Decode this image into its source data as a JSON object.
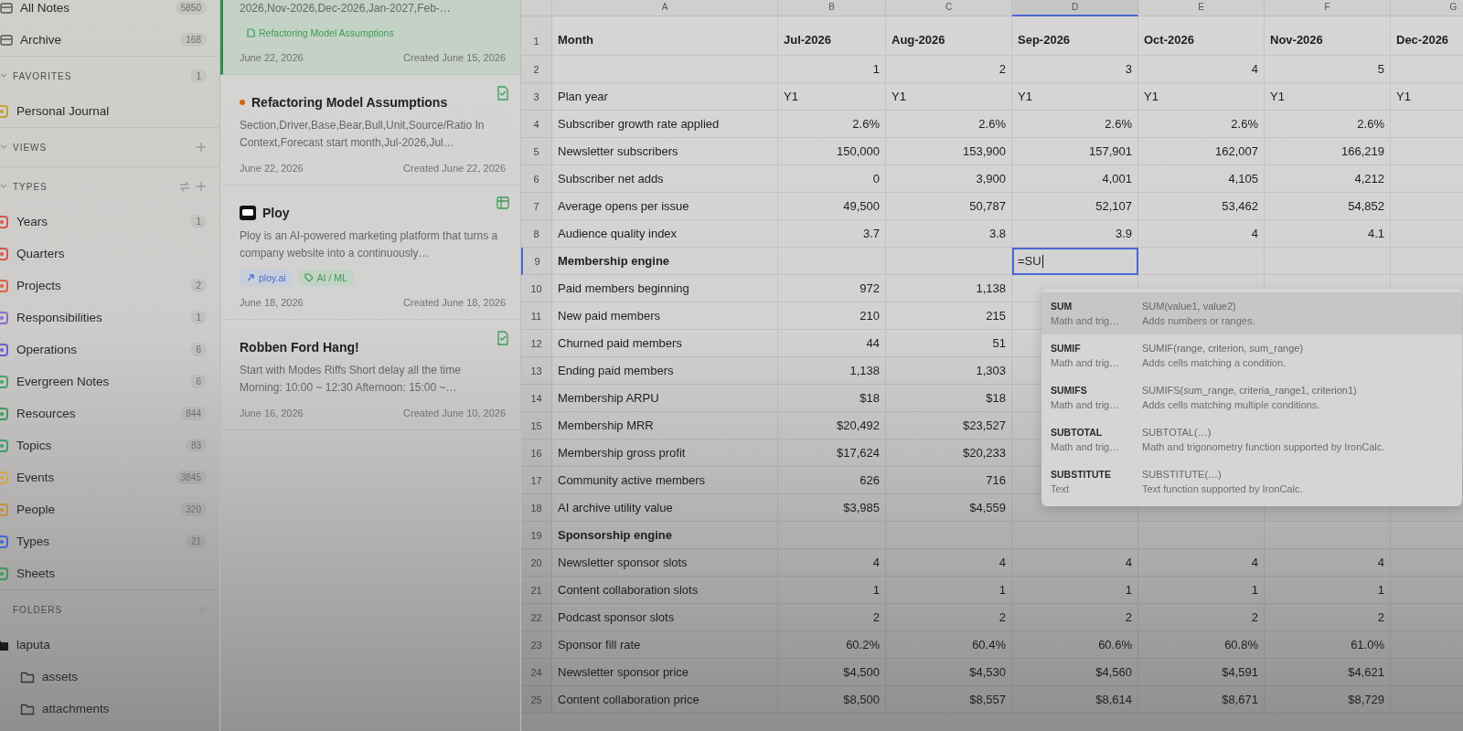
{
  "sidebar": {
    "nav": [
      {
        "label": "All Notes",
        "count": "5850"
      },
      {
        "label": "Archive",
        "count": "168"
      }
    ],
    "sections": [
      {
        "title": "FAVORITES",
        "count": "1",
        "expanded": true,
        "sort_button": false,
        "add_button": false,
        "items": [
          {
            "label": "Personal Journal",
            "color": "#c9a227"
          }
        ]
      },
      {
        "title": "VIEWS",
        "expanded": true,
        "sort_button": false,
        "add_button": true
      },
      {
        "title": "TYPES",
        "expanded": true,
        "sort_button": true,
        "add_button": true,
        "items": [
          {
            "label": "Years",
            "count": "1",
            "color": "#d9534f"
          },
          {
            "label": "Quarters",
            "color": "#d9534f"
          },
          {
            "label": "Projects",
            "count": "2",
            "color": "#e0603a"
          },
          {
            "label": "Responsibilities",
            "count": "1",
            "color": "#8a6bd1"
          },
          {
            "label": "Operations",
            "count": "6",
            "color": "#6b5bd1"
          },
          {
            "label": "Evergreen Notes",
            "count": "6",
            "color": "#3fa66b"
          },
          {
            "label": "Resources",
            "count": "844",
            "color": "#3f9a5a"
          },
          {
            "label": "Topics",
            "count": "83",
            "color": "#3aa070"
          },
          {
            "label": "Events",
            "count": "3845",
            "color": "#d9a53f"
          },
          {
            "label": "People",
            "count": "320",
            "color": "#c98f3a"
          },
          {
            "label": "Types",
            "count": "21",
            "color": "#3f6bd9"
          },
          {
            "label": "Sheets",
            "color": "#3f9a5a"
          }
        ]
      },
      {
        "title": "FOLDERS",
        "expanded": true,
        "sort_button": false,
        "add_button": true,
        "items": [
          {
            "label": "laputa",
            "kind": "folder",
            "children": [
              {
                "label": "assets",
                "kind": "folder"
              },
              {
                "label": "attachments",
                "kind": "folder"
              }
            ]
          }
        ]
      }
    ]
  },
  "notes": [
    {
      "selected": true,
      "kind": "none",
      "preview": "2026,Nov-2026,Dec-2026,Jan-2027,Feb-…",
      "chips": [
        {
          "kind": "note",
          "label": "Refactoring Model Assumptions"
        }
      ],
      "date": "June 22, 2026",
      "created": "Created June 15, 2026"
    },
    {
      "selected": false,
      "kind": "note",
      "logo": false,
      "color": "#d9640f",
      "title": "Refactoring Model Assumptions",
      "preview": "Section,Driver,Base,Bear,Bull,Unit,Source/Ratio In Context,Forecast start month,Jul-2026,Jul…",
      "date": "June 22, 2026",
      "created": "Created June 22, 2026"
    },
    {
      "selected": false,
      "kind": "sheet",
      "logo": true,
      "title": "Ploy",
      "preview": "Ploy is an AI-powered marketing platform that turns a company website into a continuously…",
      "chips": [
        {
          "kind": "link",
          "label": "ploy.ai"
        },
        {
          "kind": "tag",
          "label": "AI / ML"
        }
      ],
      "date": "June 18, 2026",
      "created": "Created June 18, 2026"
    },
    {
      "selected": false,
      "kind": "note",
      "logo": false,
      "title": "Robben Ford Hang!",
      "preview": "Start with Modes Riffs Short delay all the time Morning: 10:00 ~ 12:30 Afternoon: 15:00 ~…",
      "date": "June 16, 2026",
      "created": "Created June 10, 2026"
    }
  ],
  "sheet": {
    "columns": [
      {
        "label": "A",
        "selected": false
      },
      {
        "label": "B",
        "selected": false
      },
      {
        "label": "C",
        "selected": false
      },
      {
        "label": "D",
        "selected": true
      },
      {
        "label": "E",
        "selected": false
      },
      {
        "label": "F",
        "selected": false
      },
      {
        "label": "G",
        "selected": false
      }
    ],
    "rows": [
      {
        "number": "1",
        "kind": "header",
        "selected": false,
        "cells": [
          "Month",
          "Jul-2026",
          "Aug-2026",
          "Sep-2026",
          "Oct-2026",
          "Nov-2026",
          "Dec-2026"
        ]
      },
      {
        "number": "2",
        "kind": "number",
        "selected": false,
        "cells": [
          "",
          "1",
          "2",
          "3",
          "4",
          "5"
        ]
      },
      {
        "number": "3",
        "kind": "text",
        "selected": false,
        "cells": [
          "Plan year",
          "Y1",
          "Y1",
          "Y1",
          "Y1",
          "Y1",
          "Y1"
        ]
      },
      {
        "number": "4",
        "kind": "number",
        "selected": false,
        "cells": [
          "Subscriber growth rate applied",
          "2.6%",
          "2.6%",
          "2.6%",
          "2.6%",
          "2.6%"
        ]
      },
      {
        "number": "5",
        "kind": "number",
        "selected": false,
        "cells": [
          "Newsletter subscribers",
          "150,000",
          "153,900",
          "157,901",
          "162,007",
          "166,219"
        ]
      },
      {
        "number": "6",
        "kind": "number",
        "selected": false,
        "cells": [
          "Subscriber net adds",
          "0",
          "3,900",
          "4,001",
          "4,105",
          "4,212"
        ]
      },
      {
        "number": "7",
        "kind": "number",
        "selected": false,
        "cells": [
          "Average opens per issue",
          "49,500",
          "50,787",
          "52,107",
          "53,462",
          "54,852"
        ]
      },
      {
        "number": "8",
        "kind": "number",
        "selected": false,
        "cells": [
          "Audience quality index",
          "3.7",
          "3.8",
          "3.9",
          "4",
          "4.1"
        ]
      },
      {
        "number": "9",
        "kind": "section",
        "selected": true,
        "cells": [
          "Membership engine",
          "",
          "",
          {
            "text": "=SU",
            "editing": true
          }
        ]
      },
      {
        "number": "10",
        "kind": "number",
        "selected": false,
        "cells": [
          "Paid members beginning",
          "972",
          "1,138"
        ]
      },
      {
        "number": "11",
        "kind": "number",
        "selected": false,
        "cells": [
          "New paid members",
          "210",
          "215"
        ]
      },
      {
        "number": "12",
        "kind": "number",
        "selected": false,
        "cells": [
          "Churned paid members",
          "44",
          "51"
        ]
      },
      {
        "number": "13",
        "kind": "number",
        "selected": false,
        "cells": [
          "Ending paid members",
          "1,138",
          "1,303"
        ]
      },
      {
        "number": "14",
        "kind": "number",
        "selected": false,
        "cells": [
          "Membership ARPU",
          "$18",
          "$18"
        ]
      },
      {
        "number": "15",
        "kind": "number",
        "selected": false,
        "cells": [
          "Membership MRR",
          "$20,492",
          "$23,527"
        ]
      },
      {
        "number": "16",
        "kind": "number",
        "selected": false,
        "cells": [
          "Membership gross profit",
          "$17,624",
          "$20,233"
        ]
      },
      {
        "number": "17",
        "kind": "number",
        "selected": false,
        "cells": [
          "Community active members",
          "626",
          "716"
        ]
      },
      {
        "number": "18",
        "kind": "number",
        "selected": false,
        "cells": [
          "AI archive utility value",
          "$3,985",
          "$4,559"
        ]
      },
      {
        "number": "19",
        "kind": "section",
        "selected": false,
        "cells": [
          "Sponsorship engine"
        ]
      },
      {
        "number": "20",
        "kind": "number",
        "selected": false,
        "cells": [
          "Newsletter sponsor slots",
          "4",
          "4",
          "4",
          "4",
          "4"
        ]
      },
      {
        "number": "21",
        "kind": "number",
        "selected": false,
        "cells": [
          "Content collaboration slots",
          "1",
          "1",
          "1",
          "1",
          "1"
        ]
      },
      {
        "number": "22",
        "kind": "number",
        "selected": false,
        "cells": [
          "Podcast sponsor slots",
          "2",
          "2",
          "2",
          "2",
          "2"
        ]
      },
      {
        "number": "23",
        "kind": "number",
        "selected": false,
        "cells": [
          "Sponsor fill rate",
          "60.2%",
          "60.4%",
          "60.6%",
          "60.8%",
          "61.0%"
        ]
      },
      {
        "number": "24",
        "kind": "number",
        "selected": false,
        "cells": [
          "Newsletter sponsor price",
          "$4,500",
          "$4,530",
          "$4,560",
          "$4,591",
          "$4,621"
        ]
      },
      {
        "number": "25",
        "kind": "number",
        "selected": false,
        "cells": [
          "Content collaboration price",
          "$8,500",
          "$8,557",
          "$8,614",
          "$8,671",
          "$8,729"
        ]
      }
    ],
    "suggestions": [
      {
        "name": "SUM",
        "category": "Math and trig…",
        "signature": "SUM(value1, value2)",
        "description": "Adds numbers or ranges.",
        "selected": true
      },
      {
        "name": "SUMIF",
        "category": "Math and trig…",
        "signature": "SUMIF(range, criterion, sum_range)",
        "description": "Adds cells matching a condition.",
        "selected": false
      },
      {
        "name": "SUMIFS",
        "category": "Math and trig…",
        "signature": "SUMIFS(sum_range, criteria_range1, criterion1)",
        "description": "Adds cells matching multiple conditions.",
        "selected": false
      },
      {
        "name": "SUBTOTAL",
        "category": "Math and trig…",
        "signature": "SUBTOTAL(…)",
        "description": "Math and trigonometry function supported by IronCalc.",
        "selected": false
      },
      {
        "name": "SUBSTITUTE",
        "category": "Text",
        "signature": "SUBSTITUTE(…)",
        "description": "Text function supported by IronCalc.",
        "selected": false
      }
    ]
  }
}
